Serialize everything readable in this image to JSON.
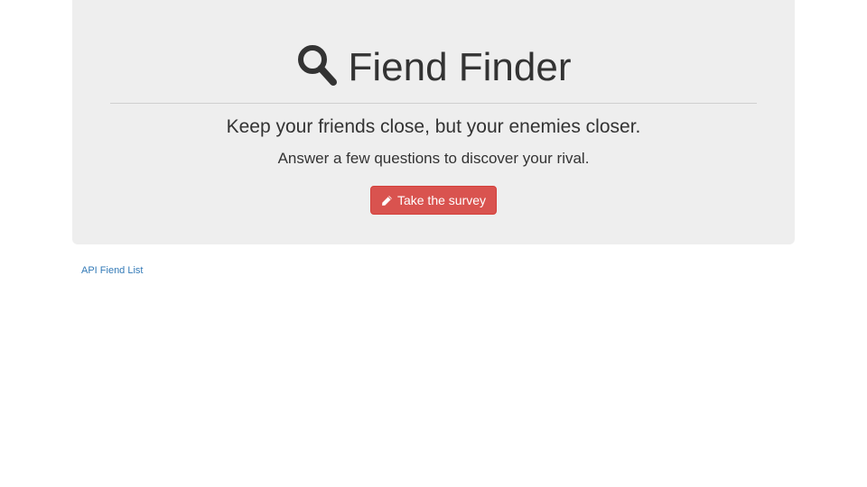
{
  "header": {
    "title": "Fiend Finder",
    "title_icon": "search-icon",
    "tagline": "Keep your friends close, but your enemies closer.",
    "subtext": "Answer a few questions to discover your rival.",
    "cta": {
      "label": "Take the survey",
      "icon": "pencil-icon",
      "color": "#d9534f"
    }
  },
  "footer": {
    "api_link_label": "API Fiend List",
    "link_color": "#337ab7"
  },
  "colors": {
    "panel_background": "#eeeeee",
    "text": "#333333"
  }
}
